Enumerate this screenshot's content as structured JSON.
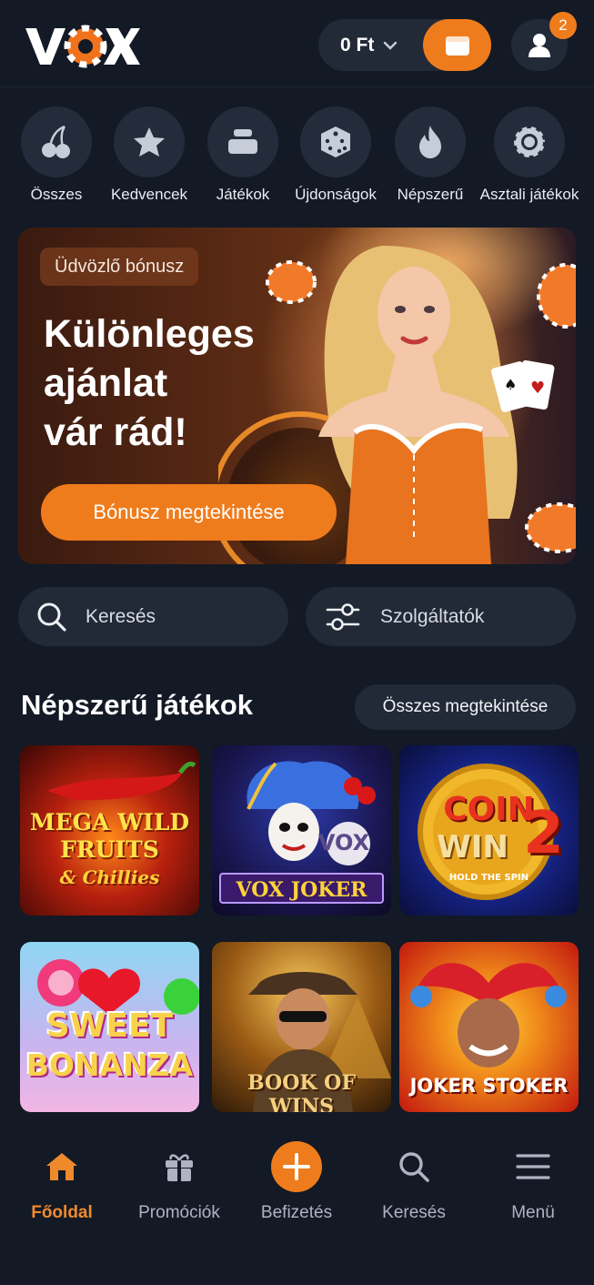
{
  "header": {
    "logo_text": "VOX",
    "balance": "0 Ft",
    "notification_count": "2"
  },
  "categories": [
    {
      "label": "Összes",
      "icon": "cherry-icon"
    },
    {
      "label": "Kedvencek",
      "icon": "star-icon"
    },
    {
      "label": "Játékok",
      "icon": "stack-icon"
    },
    {
      "label": "Újdonságok",
      "icon": "dice-icon"
    },
    {
      "label": "Népszerű",
      "icon": "fire-icon"
    },
    {
      "label": "Asztali játékok",
      "icon": "chip-icon"
    }
  ],
  "banner": {
    "tag": "Üdvözlő bónusz",
    "title_line1": "Különleges",
    "title_line2": "ajánlat",
    "title_line3": "vár rád!",
    "button": "Bónusz megtekintése"
  },
  "search": {
    "placeholder": "Keresés"
  },
  "providers": {
    "label": "Szolgáltatók"
  },
  "popular": {
    "title": "Népszerű játékok",
    "see_all": "Összes megtekintése",
    "games": [
      {
        "line1": "MEGA WILD",
        "line2": "FRUITS",
        "line3": "& Chillies"
      },
      {
        "line1": "VOX",
        "line2": "VOX JOKER"
      },
      {
        "line1": "COIN",
        "line2": "WIN",
        "line3": "2",
        "line4": "HOLD THE SPIN"
      },
      {
        "line1": "SWEET",
        "line2": "BONANZA"
      },
      {
        "line1": "BOOK OF WINS"
      },
      {
        "line1": "JOKER STOKER"
      }
    ]
  },
  "bottom_nav": [
    {
      "label": "Főoldal",
      "icon": "home-icon",
      "active": true
    },
    {
      "label": "Promóciók",
      "icon": "gift-icon"
    },
    {
      "label": "Befizetés",
      "icon": "plus-icon"
    },
    {
      "label": "Keresés",
      "icon": "search-icon"
    },
    {
      "label": "Menü",
      "icon": "menu-icon"
    }
  ],
  "colors": {
    "accent": "#ef7c1c",
    "background": "#131925",
    "surface": "#222937"
  }
}
